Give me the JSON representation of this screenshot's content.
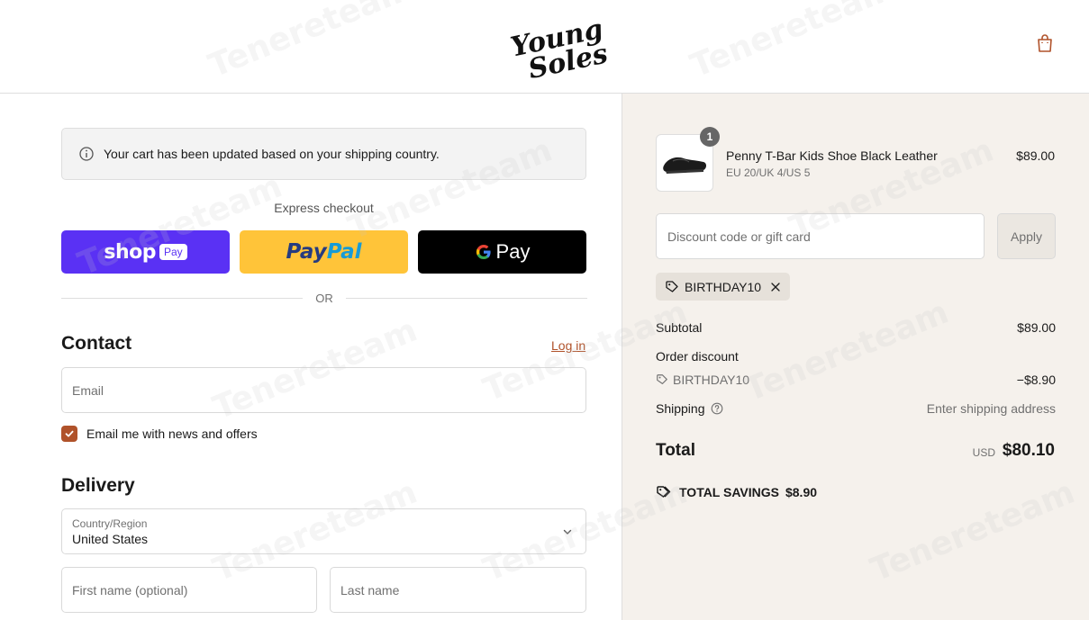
{
  "header": {
    "logo_text": "Young Soles",
    "cart_icon": "shopping-bag-icon"
  },
  "notice": {
    "text": "Your cart has been updated based on your shipping country.",
    "icon": "info-icon"
  },
  "express": {
    "label": "Express checkout",
    "shop_pay": "shop",
    "shop_pay_badge": "Pay",
    "paypal_a": "Pay",
    "paypal_b": "Pal",
    "gpay": "Pay",
    "or_label": "OR"
  },
  "contact": {
    "title": "Contact",
    "login": "Log in",
    "email_placeholder": "Email",
    "newsletter_label": "Email me with news and offers",
    "newsletter_checked": true
  },
  "delivery": {
    "title": "Delivery",
    "country_label": "Country/Region",
    "country_value": "United States",
    "first_name_placeholder": "First name (optional)",
    "last_name_placeholder": "Last name"
  },
  "summary": {
    "product": {
      "name": "Penny T-Bar Kids Shoe Black Leather",
      "variant": "EU 20/UK 4/US 5",
      "price": "$89.00",
      "quantity": "1"
    },
    "discount_placeholder": "Discount code or gift card",
    "apply_label": "Apply",
    "applied_code": "BIRTHDAY10",
    "subtotal_label": "Subtotal",
    "subtotal_value": "$89.00",
    "order_discount_label": "Order discount",
    "discount_code": "BIRTHDAY10",
    "discount_value": "−$8.90",
    "shipping_label": "Shipping",
    "shipping_value": "Enter shipping address",
    "total_label": "Total",
    "total_currency": "USD",
    "total_value": "$80.10",
    "savings_label": "TOTAL SAVINGS",
    "savings_value": "$8.90"
  },
  "colors": {
    "accent": "#b0522a",
    "shop_pay": "#5a31f4",
    "paypal": "#ffc439",
    "gpay": "#000000",
    "summary_bg": "#f5f1ec"
  },
  "watermark": "Tenereteam"
}
